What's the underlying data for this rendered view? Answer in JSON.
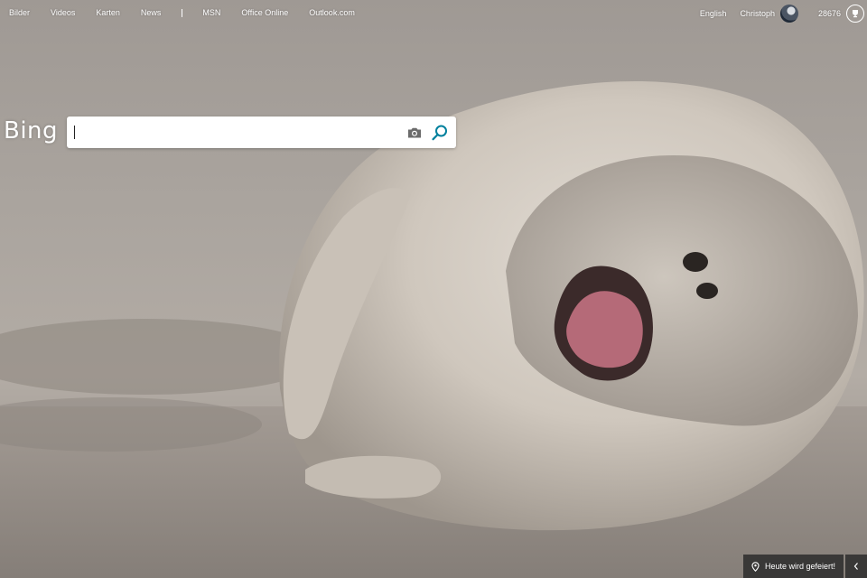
{
  "nav": {
    "items": [
      {
        "label": "Bilder"
      },
      {
        "label": "Videos"
      },
      {
        "label": "Karten"
      },
      {
        "label": "News"
      },
      {
        "label": "MSN"
      },
      {
        "label": "Office Online"
      },
      {
        "label": "Outlook.com"
      }
    ]
  },
  "header": {
    "language": "English",
    "user_name": "Christoph",
    "points": "28676",
    "avatar_icon": "avatar",
    "rewards_icon": "trophy-icon"
  },
  "brand": {
    "logo": "Bing"
  },
  "search": {
    "value": "",
    "placeholder": "",
    "camera_icon": "camera-icon",
    "search_icon": "search-icon",
    "accent_color": "#00809d"
  },
  "bottom": {
    "info_label": "Heute wird gefeiert!",
    "location_icon": "location-pin-icon",
    "collapse_icon": "chevron-left-icon"
  }
}
